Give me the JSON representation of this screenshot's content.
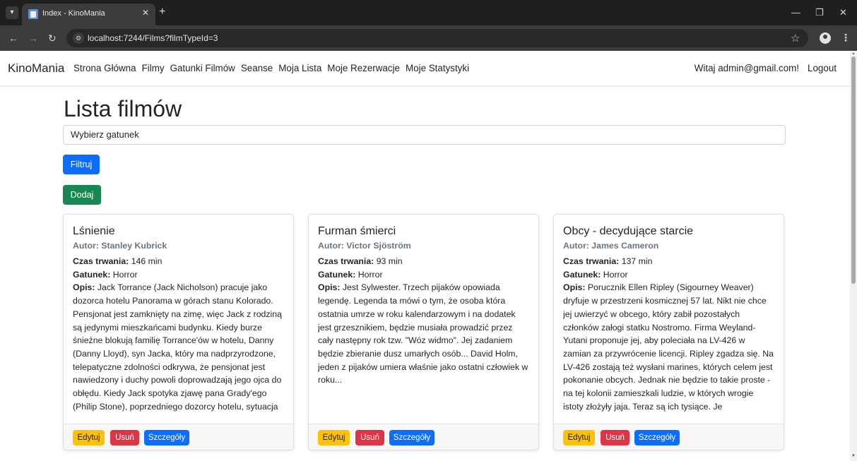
{
  "browser": {
    "tab_title": "Index - KinoMania",
    "url": "localhost:7244/Films?filmTypeId=3",
    "tab_close": "✕",
    "new_tab": "+",
    "minimize": "—",
    "restore": "❐",
    "close": "✕"
  },
  "navbar": {
    "brand": "KinoMania",
    "links": [
      "Strona Główna",
      "Filmy",
      "Gatunki Filmów",
      "Seanse",
      "Moja Lista",
      "Moje Rezerwacje",
      "Moje Statystyki"
    ],
    "greeting": "Witaj admin@gmail.com!",
    "logout": "Logout"
  },
  "page": {
    "title": "Lista filmów",
    "genre_select": "Wybierz gatunek",
    "filter_button": "Filtruj",
    "add_button": "Dodaj"
  },
  "labels": {
    "duration": "Czas trwania:",
    "genre": "Gatunek:",
    "description": "Opis:",
    "edit": "Edytuj",
    "delete": "Usuń",
    "details": "Szczegóły"
  },
  "films": [
    {
      "title": "Lśnienie",
      "author": "Autor: Stanley Kubrick",
      "duration": "146 min",
      "genre": "Horror",
      "description": "Jack Torrance (Jack Nicholson) pracuje jako dozorca hotelu Panorama w górach stanu Kolorado. Pensjonat jest zamknięty na zimę, więc Jack z rodziną są jedynymi mieszkańcami budynku. Kiedy burze śnieżne blokują familię Torrance'ów w hotelu, Danny (Danny Lloyd), syn Jacka, który ma nadprzyrodzone, telepatyczne zdolności odkrywa, że pensjonat jest nawiedzony i duchy powoli doprowadzają jego ojca do obłędu. Kiedy Jack spotyka zjawę pana Grady'ego (Philip Stone), poprzedniego dozorcy hotelu, sytuacja"
    },
    {
      "title": "Furman śmierci",
      "author": "Autor: Victor Sjöström",
      "duration": "93 min",
      "genre": "Horror",
      "description": "Jest Sylwester. Trzech pijaków opowiada legendę. Legenda ta mówi o tym, że osoba która ostatnia umrze w roku kalendarzowym i na dodatek jest grzesznikiem, będzie musiała prowadzić przez cały następny rok tzw. \"Wóz widmo\". Jej zadaniem będzie zbieranie dusz umarłych osób... David Holm, jeden z pijaków umiera właśnie jako ostatni człowiek w roku..."
    },
    {
      "title": "Obcy - decydujące starcie",
      "author": "Autor: James Cameron",
      "duration": "137 min",
      "genre": "Horror",
      "description": "Porucznik Ellen Ripley (Sigourney Weaver) dryfuje w przestrzeni kosmicznej 57 lat. Nikt nie chce jej uwierzyć w obcego, który zabił pozostałych członków załogi statku Nostromo. Firma Weyland-Yutani proponuje jej, aby poleciała na LV-426 w zamian za przywrócenie licencji. Ripley zgadza się. Na LV-426 zostają też wysłani marines, których celem jest pokonanie obcych. Jednak nie będzie to takie proste - na tej kolonii zamieszkali ludzie, w których wrogie istoty złożyły jaja. Teraz są ich tysiące. Je"
    }
  ]
}
